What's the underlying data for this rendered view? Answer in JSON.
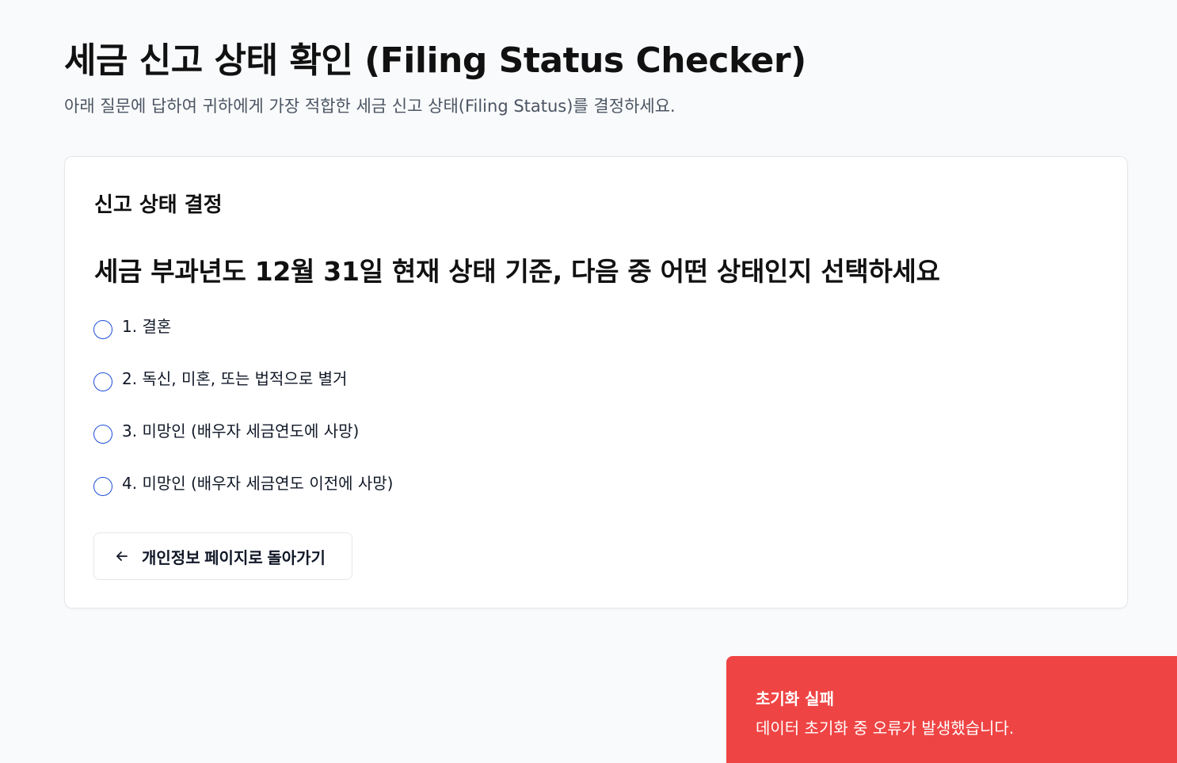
{
  "header": {
    "title": "세금 신고 상태 확인 (Filing Status Checker)",
    "subtitle": "아래 질문에 답하여 귀하에게 가장 적합한 세금 신고 상태(Filing Status)를 결정하세요."
  },
  "card": {
    "title": "신고 상태 결정",
    "question": "세금 부과년도 12월 31일 현재 상태 기준, 다음 중 어떤 상태인지 선택하세요",
    "options": [
      {
        "label": "1. 결혼"
      },
      {
        "label": "2. 독신, 미혼, 또는 법적으로 별거"
      },
      {
        "label": "3. 미망인 (배우자 세금연도에 사망)"
      },
      {
        "label": "4. 미망인 (배우자 세금연도 이전에 사망)"
      }
    ],
    "back_button": {
      "label": "개인정보 페이지로 돌아가기",
      "icon": "arrow-left-icon"
    }
  },
  "toast": {
    "title": "초기화 실패",
    "message": "데이터 초기화 중 오류가 발생했습니다.",
    "color": "#ef4444"
  },
  "colors": {
    "background": "#f9fafb",
    "radio_border": "#1d4ed8",
    "subtitle_text": "#4b5563"
  }
}
